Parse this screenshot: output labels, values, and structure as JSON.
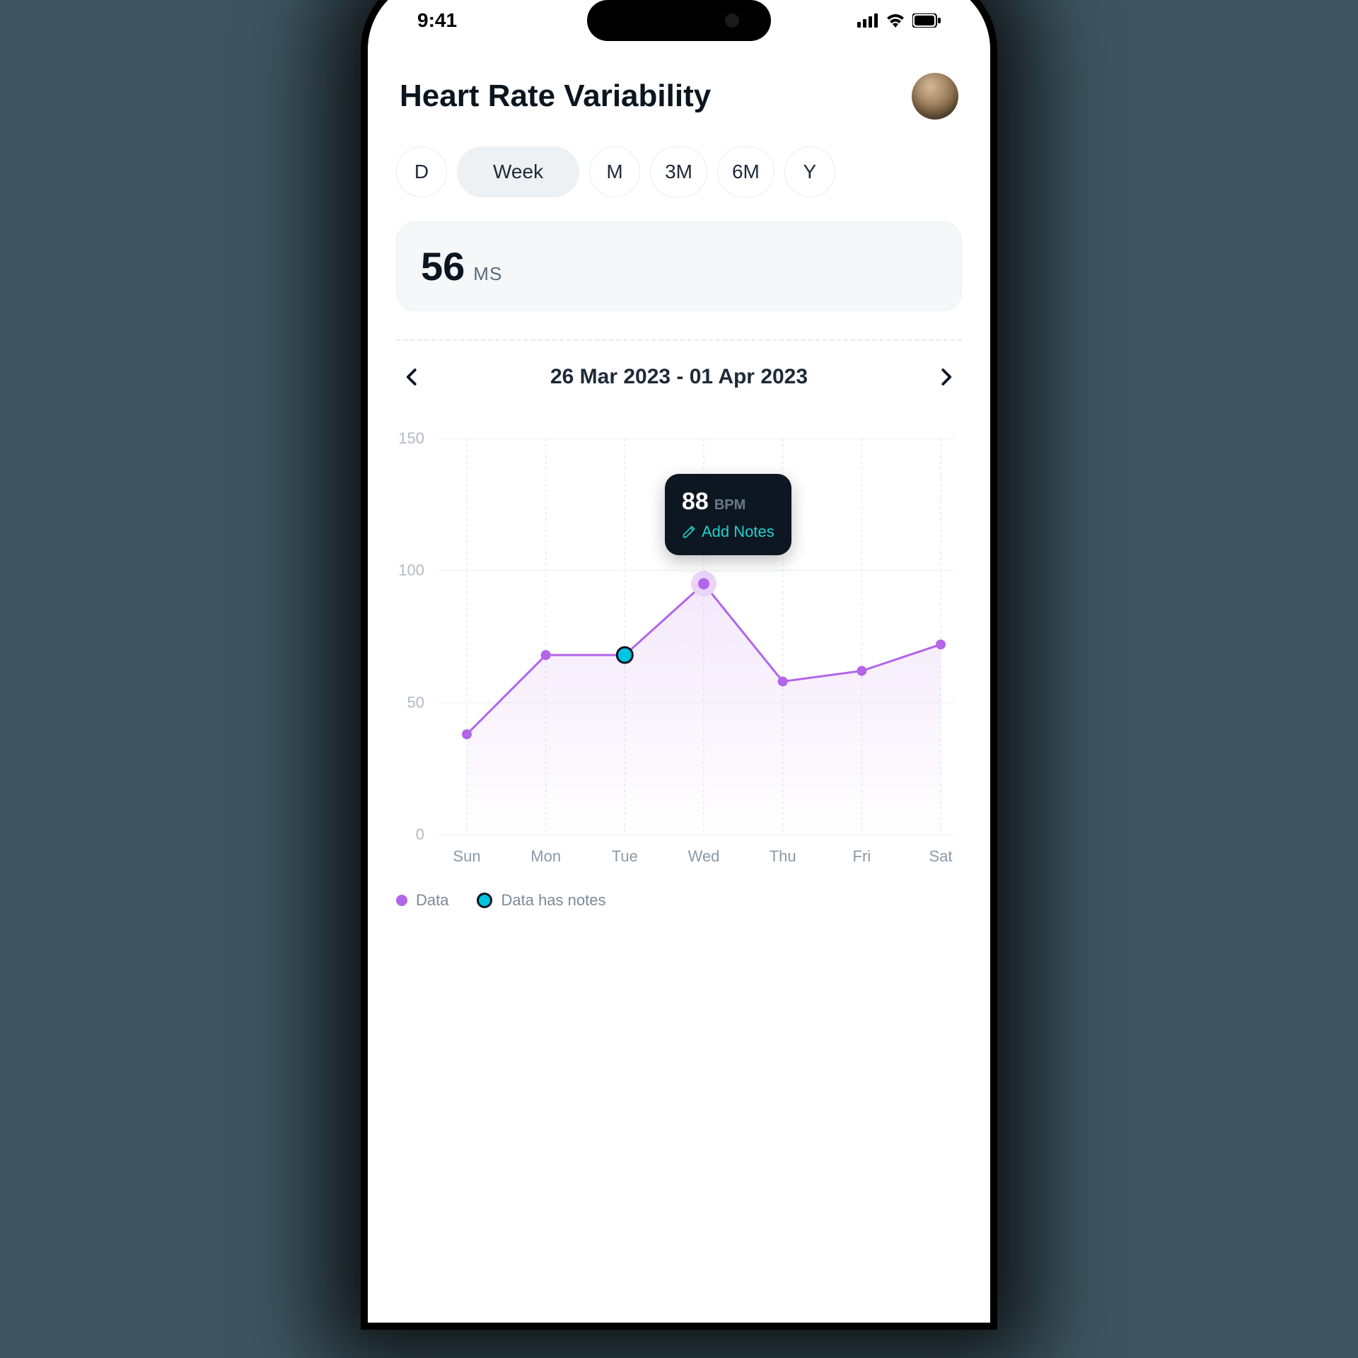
{
  "status": {
    "time": "9:41"
  },
  "header": {
    "title": "Heart Rate Variability"
  },
  "ranges": {
    "items": [
      {
        "label": "D"
      },
      {
        "label": "Week"
      },
      {
        "label": "M"
      },
      {
        "label": "3M"
      },
      {
        "label": "6M"
      },
      {
        "label": "Y"
      }
    ],
    "active_index": 1
  },
  "metric": {
    "value": "56",
    "unit": "MS"
  },
  "date_range": "26 Mar 2023 - 01 Apr 2023",
  "tooltip": {
    "value": "88",
    "unit": "BPM",
    "action": "Add Notes"
  },
  "legend": {
    "data": "Data",
    "notes": "Data has notes"
  },
  "chart_data": {
    "type": "line",
    "title": "",
    "xlabel": "",
    "ylabel": "",
    "ylim": [
      0,
      150
    ],
    "y_ticks": [
      150,
      100,
      50,
      0
    ],
    "categories": [
      "Sun",
      "Mon",
      "Tue",
      "Wed",
      "Thu",
      "Fri",
      "Sat"
    ],
    "values": [
      38,
      68,
      68,
      95,
      58,
      62,
      72
    ],
    "highlight_index": 3,
    "has_notes_index": [
      2
    ]
  }
}
